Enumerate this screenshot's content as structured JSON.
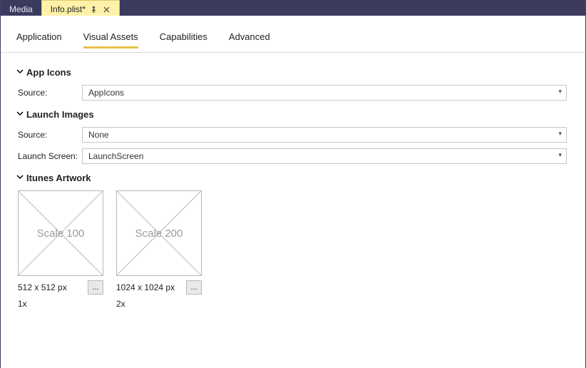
{
  "doc_tabs": {
    "inactive": "Media",
    "active": "Info.plist*"
  },
  "subtabs": {
    "application": "Application",
    "visual_assets": "Visual Assets",
    "capabilities": "Capabilities",
    "advanced": "Advanced"
  },
  "sections": {
    "app_icons": {
      "title": "App Icons",
      "source_label": "Source:",
      "source_value": "AppIcons"
    },
    "launch_images": {
      "title": "Launch Images",
      "source_label": "Source:",
      "source_value": "None",
      "launch_screen_label": "Launch Screen:",
      "launch_screen_value": "LaunchScreen"
    },
    "itunes_artwork": {
      "title": "Itunes Artwork",
      "slots": [
        {
          "placeholder": "Scale 100",
          "dim": "512 x 512 px",
          "mult": "1x",
          "ellipsis": "..."
        },
        {
          "placeholder": "Scale 200",
          "dim": "1024 x 1024 px",
          "mult": "2x",
          "ellipsis": "..."
        }
      ]
    }
  }
}
